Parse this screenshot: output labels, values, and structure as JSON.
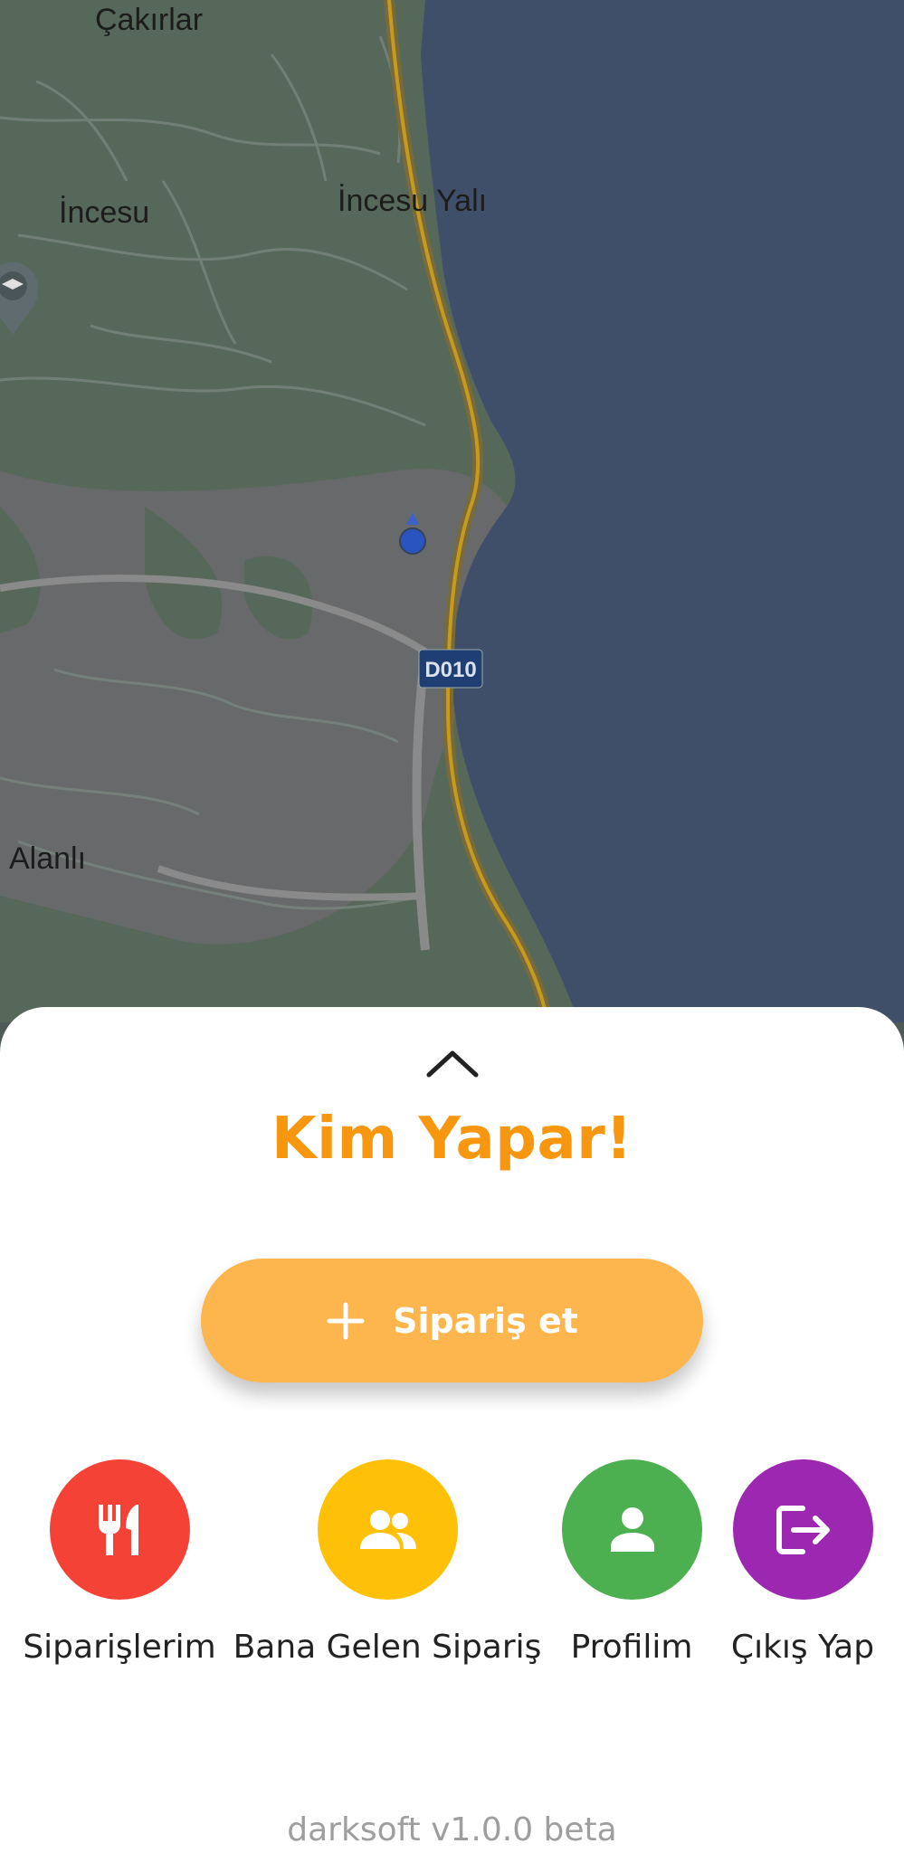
{
  "map": {
    "labels": {
      "cakirlar": "Çakırlar",
      "incesu": "İncesu",
      "incesu_yali": "İncesu Yalı",
      "alanli": "Alanlı",
      "road_shield": "D010"
    }
  },
  "sheet": {
    "title": "Kim Yapar!",
    "order_button": "Sipariş et",
    "actions": [
      {
        "label": "Siparişlerim",
        "color": "#f44336",
        "icon": "cutlery-icon"
      },
      {
        "label": "Bana Gelen Sipariş",
        "color": "#ffc107",
        "icon": "people-icon"
      },
      {
        "label": "Profilim",
        "color": "#4caf50",
        "icon": "person-icon"
      },
      {
        "label": "Çıkış Yap",
        "color": "#9c27b0",
        "icon": "logout-icon"
      }
    ],
    "footer": "darksoft v1.0.0 beta"
  },
  "colors": {
    "accent": "#f7960f",
    "button": "#fdb54d",
    "sea": "#404f69",
    "land": "#56685a"
  }
}
